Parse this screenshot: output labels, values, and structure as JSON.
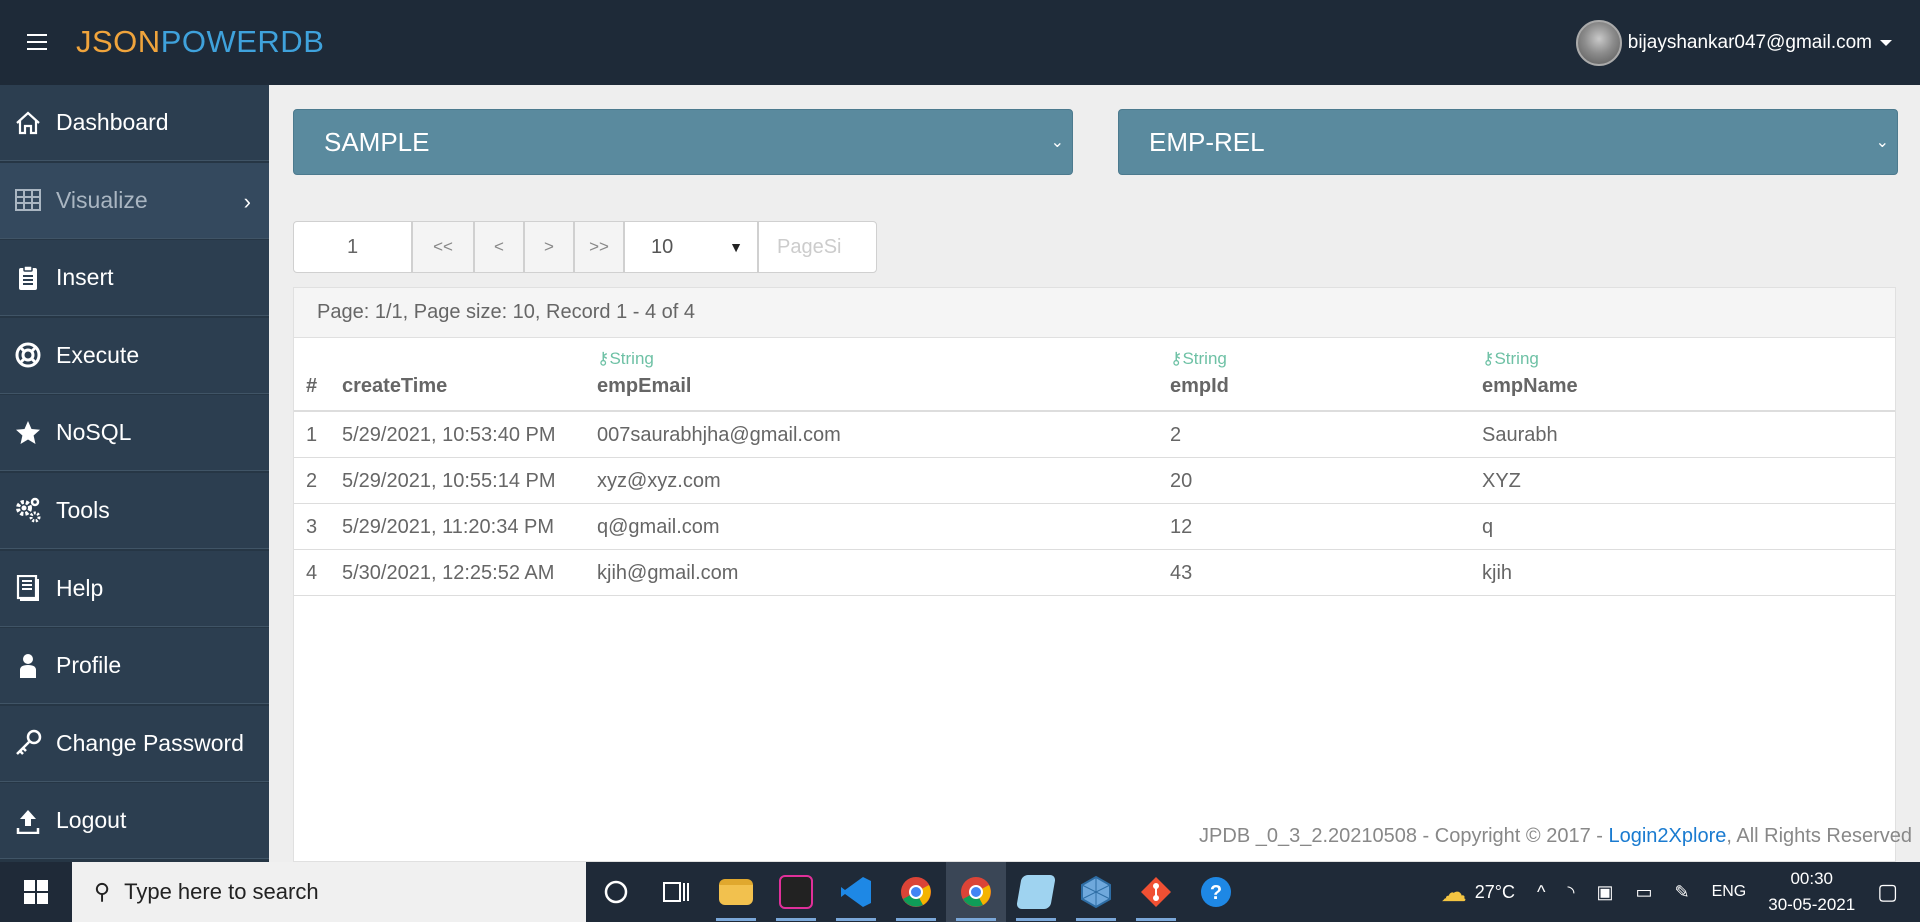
{
  "header": {
    "logo_part1": "JSON",
    "logo_part2": "POWERDB",
    "user_email": "bijayshankar047@gmail.com"
  },
  "sidebar": {
    "items": [
      {
        "label": "Dashboard",
        "icon": "home-icon"
      },
      {
        "label": "Visualize",
        "icon": "table-icon"
      },
      {
        "label": "Insert",
        "icon": "clipboard-icon"
      },
      {
        "label": "Execute",
        "icon": "lifebuoy-icon"
      },
      {
        "label": "NoSQL",
        "icon": "star-icon"
      },
      {
        "label": "Tools",
        "icon": "gears-icon"
      },
      {
        "label": "Help",
        "icon": "book-icon"
      },
      {
        "label": "Profile",
        "icon": "user-icon"
      },
      {
        "label": "Change Password",
        "icon": "key-icon"
      },
      {
        "label": "Logout",
        "icon": "upload-icon"
      }
    ]
  },
  "selects": {
    "database": "SAMPLE",
    "relation": "EMP-REL"
  },
  "pager": {
    "page_number": "1",
    "first": "<<",
    "prev": "<",
    "next": ">",
    "last": ">>",
    "page_size": "10",
    "page_size_placeholder": "PageSi"
  },
  "status": "Page: 1/1, Page size: 10, Record 1 - 4 of 4",
  "table": {
    "columns": [
      {
        "type": "",
        "name": "#"
      },
      {
        "type": "",
        "name": "createTime"
      },
      {
        "type": "String",
        "name": "empEmail"
      },
      {
        "type": "String",
        "name": "empId"
      },
      {
        "type": "String",
        "name": "empName"
      }
    ],
    "rows": [
      [
        "1",
        "5/29/2021, 10:53:40 PM",
        "007saurabhjha@gmail.com",
        "2",
        "Saurabh"
      ],
      [
        "2",
        "5/29/2021, 10:55:14 PM",
        "xyz@xyz.com",
        "20",
        "XYZ"
      ],
      [
        "3",
        "5/29/2021, 11:20:34 PM",
        "q@gmail.com",
        "12",
        "q"
      ],
      [
        "4",
        "5/30/2021, 12:25:52 AM",
        "kjih@gmail.com",
        "43",
        "kjih"
      ]
    ]
  },
  "footer": {
    "prefix": "JPDB _0_3_2.20210508 - Copyright © 2017 - ",
    "link": "Login2Xplore",
    "suffix": ", All Rights Reserved"
  },
  "taskbar": {
    "search_placeholder": "Type here to search",
    "weather": "27°C",
    "language": "ENG",
    "time": "00:30",
    "date": "30-05-2021"
  },
  "colors": {
    "topbar": "#1e2a38",
    "sidebar": "#2c3e50",
    "select": "#5a8a9e",
    "logo_orange": "#f0a43c",
    "logo_blue": "#3fa2dc",
    "type_green": "#6ec1a5",
    "link": "#1a7bd0"
  }
}
